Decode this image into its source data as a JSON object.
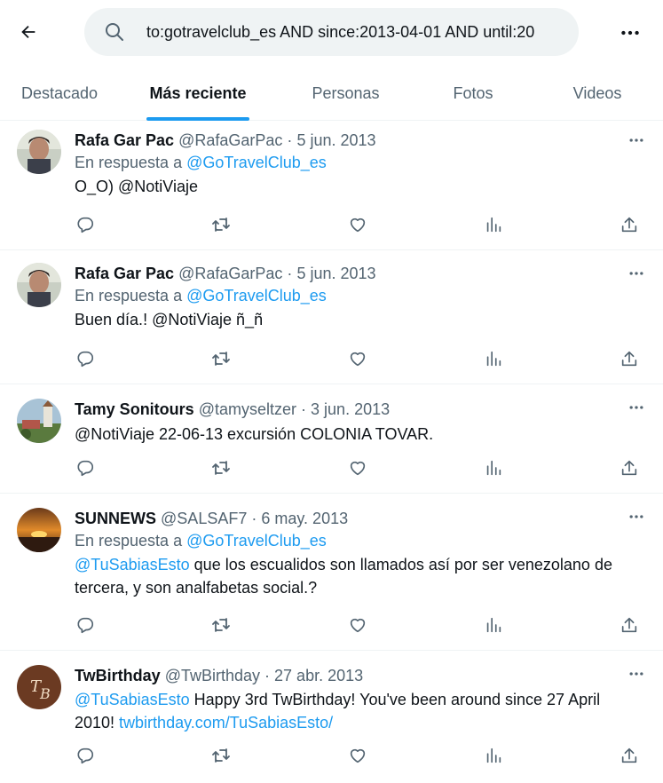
{
  "search": {
    "query": "to:gotravelclub_es AND since:2013-04-01 AND until:20"
  },
  "tabs": [
    {
      "label": "Destacado",
      "active": false
    },
    {
      "label": "Más reciente",
      "active": true
    },
    {
      "label": "Personas",
      "active": false
    },
    {
      "label": "Fotos",
      "active": false
    },
    {
      "label": "Videos",
      "active": false
    }
  ],
  "tweets": [
    {
      "name": "Rafa Gar Pac",
      "handle": "@RafaGarPac",
      "date": "5 jun. 2013",
      "reply_prefix": "En respuesta a",
      "reply_to": "@GoTravelClub_es",
      "text": "O_O) @NotiViaje"
    },
    {
      "name": "Rafa Gar Pac",
      "handle": "@RafaGarPac",
      "date": "5 jun. 2013",
      "reply_prefix": "En respuesta a",
      "reply_to": "@GoTravelClub_es",
      "text": "Buen día.! @NotiViaje ñ_ñ"
    },
    {
      "name": "Tamy Sonitours",
      "handle": "@tamyseltzer",
      "date": "3 jun. 2013",
      "text": "@NotiViaje 22-06-13 excursión COLONIA TOVAR."
    },
    {
      "name": "SUNNEWS",
      "handle": "@SALSAF7",
      "date": "6 may. 2013",
      "reply_prefix": "En respuesta a",
      "reply_to": "@GoTravelClub_es",
      "mention": "@TuSabiasEsto",
      "text_line1": " que los escualidos son llamados así por ser venezolano de",
      "text_line2": "tercera, y son analfabetas social.?"
    },
    {
      "name": "TwBirthday",
      "handle": "@TwBirthday",
      "date": "27 abr. 2013",
      "mention": "@TuSabiasEsto",
      "text_line1": " Happy 3rd TwBirthday! You've been around since 27 April",
      "text_line2": "2010! ",
      "link": "twbirthday.com/TuSabiasEsto/"
    }
  ],
  "separator": "·",
  "colors": {
    "accent": "#1d9bf0",
    "text": "#0f1419",
    "secondary": "#536471",
    "search_bg": "#eff3f4"
  },
  "icons": [
    "back-arrow-icon",
    "search-icon",
    "more-icon",
    "reply-icon",
    "retweet-icon",
    "like-icon",
    "views-icon",
    "share-icon"
  ]
}
